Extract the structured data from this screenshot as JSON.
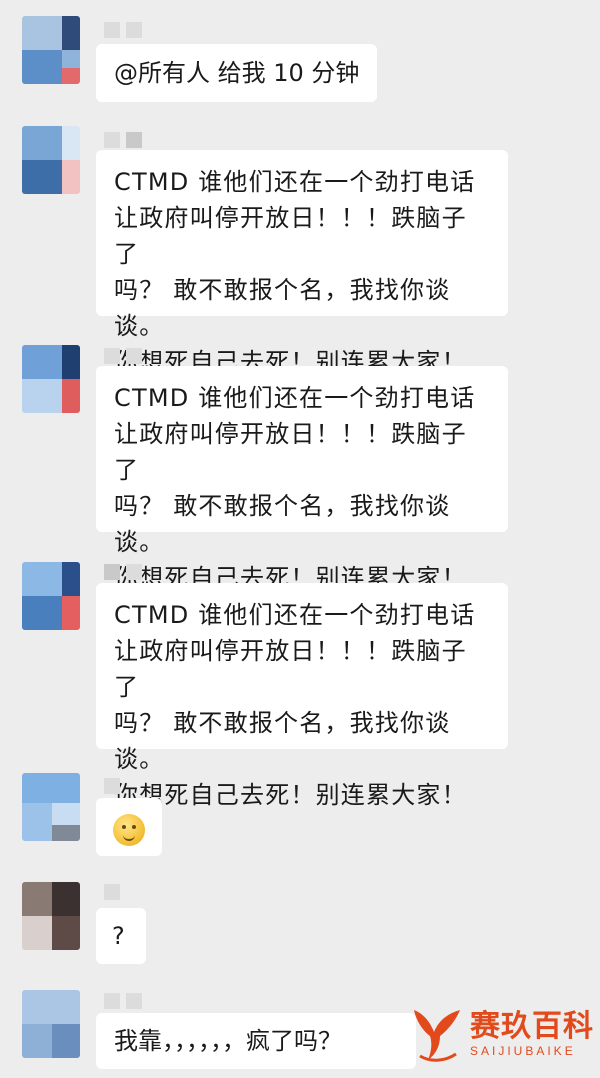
{
  "colors": {
    "background": "#ededed",
    "bubble": "#ffffff",
    "text": "#1a1a1a",
    "watermark": "#e24a1c"
  },
  "messages": [
    {
      "text": "@所有人  给我 10 分钟"
    },
    {
      "lines": [
        "CTMD 谁他们还在一个劲打电话",
        "让政府叫停开放日！！！跌脑子了",
        "吗？  敢不敢报个名，我找你谈谈。",
        "你想死自己去死！别连累大家！"
      ]
    },
    {
      "lines": [
        "CTMD 谁他们还在一个劲打电话",
        "让政府叫停开放日！！！跌脑子了",
        "吗？  敢不敢报个名，我找你谈谈。",
        "你想死自己去死！别连累大家！"
      ]
    },
    {
      "lines": [
        "CTMD 谁他们还在一个劲打电话",
        "让政府叫停开放日！！！跌脑子了",
        "吗？  敢不敢报个名，我找你谈谈。",
        "你想死自己去死！别连累大家！"
      ]
    },
    {
      "emoji": "smirk-face-icon"
    },
    {
      "text": "?"
    },
    {
      "text": "我靠，，，，，，疯了吗？"
    }
  ],
  "watermark": {
    "brand_cn": "赛玖百科",
    "brand_en": "SAIJIUBAIKE",
    "logo_icon": "whale-tail-icon"
  }
}
